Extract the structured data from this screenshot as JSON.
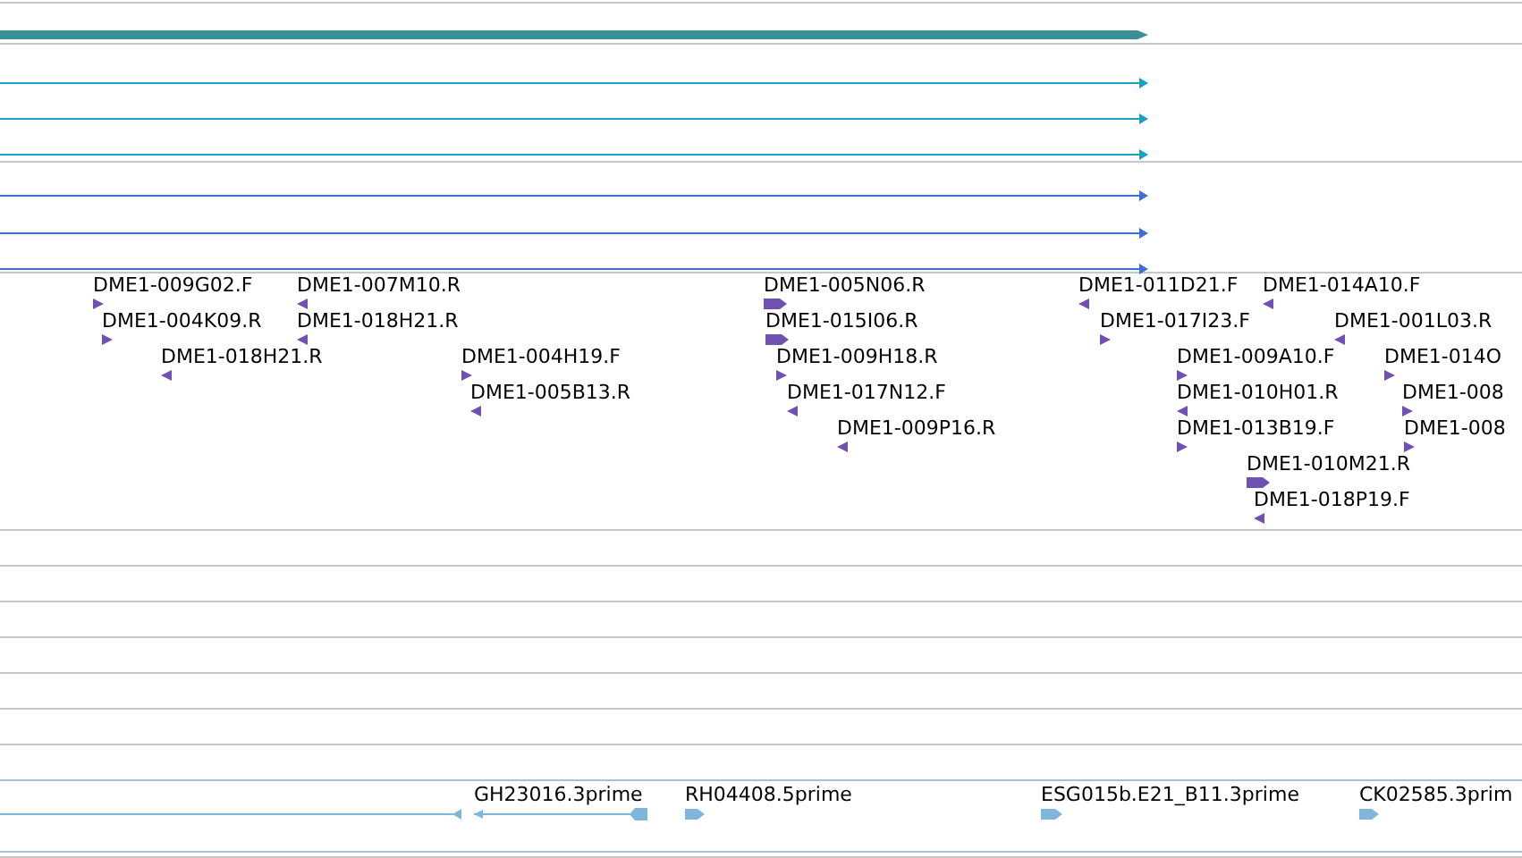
{
  "tracks": [
    {
      "kind": "thick-bar",
      "features": [
        {
          "reverse": false
        }
      ]
    },
    {
      "kind": "line-set",
      "color": "#1ba0c0",
      "features": [
        {
          "reverse": false
        },
        {
          "reverse": false
        },
        {
          "reverse": false
        }
      ]
    },
    {
      "kind": "line-set",
      "color": "#3f6fd0",
      "features": [
        {
          "reverse": false
        },
        {
          "reverse": false
        },
        {
          "reverse": false
        }
      ]
    },
    {
      "kind": "est",
      "features": [
        {
          "label": "DME1-009G02.F",
          "reverse": false,
          "wide": false
        },
        {
          "label": "DME1-004K09.R",
          "reverse": false,
          "wide": false
        },
        {
          "label": "DME1-018H21.R",
          "reverse": true,
          "wide": false
        },
        {
          "label": "DME1-007M10.R",
          "reverse": true,
          "wide": false
        },
        {
          "label": "DME1-018H21.R",
          "reverse": true,
          "wide": false
        },
        {
          "label": "DME1-004H19.F",
          "reverse": false,
          "wide": false
        },
        {
          "label": "DME1-005B13.R",
          "reverse": true,
          "wide": false
        },
        {
          "label": "DME1-005N06.R",
          "reverse": false,
          "wide": true
        },
        {
          "label": "DME1-015I06.R",
          "reverse": false,
          "wide": true
        },
        {
          "label": "DME1-009H18.R",
          "reverse": false,
          "wide": false
        },
        {
          "label": "DME1-017N12.F",
          "reverse": true,
          "wide": false
        },
        {
          "label": "DME1-009P16.R",
          "reverse": true,
          "wide": false
        },
        {
          "label": "DME1-011D21.F",
          "reverse": true,
          "wide": false
        },
        {
          "label": "DME1-014A10.F",
          "reverse": true,
          "wide": false
        },
        {
          "label": "DME1-017I23.F",
          "reverse": false,
          "wide": false
        },
        {
          "label": "DME1-001L03.R",
          "reverse": true,
          "wide": false
        },
        {
          "label": "DME1-009A10.F",
          "reverse": false,
          "wide": false
        },
        {
          "label": "DME1-014O",
          "reverse": false,
          "wide": false
        },
        {
          "label": "DME1-010H01.R",
          "reverse": true,
          "wide": false
        },
        {
          "label": "DME1-008",
          "reverse": false,
          "wide": false
        },
        {
          "label": "DME1-013B19.F",
          "reverse": false,
          "wide": false
        },
        {
          "label": "DME1-008",
          "reverse": false,
          "wide": false
        },
        {
          "label": "DME1-010M21.R",
          "reverse": false,
          "wide": true
        },
        {
          "label": "DME1-018P19.F",
          "reverse": true,
          "wide": false
        }
      ]
    },
    {
      "kind": "cdna",
      "features": [
        {
          "reverse": true
        },
        {
          "label": "GH23016.3prime",
          "reverse": true
        },
        {
          "label": "RH04408.5prime",
          "reverse": false
        },
        {
          "label": "ESG015b.E21_B11.3prime",
          "reverse": false
        },
        {
          "label": "CK02585.3prim",
          "reverse": false
        }
      ]
    }
  ]
}
